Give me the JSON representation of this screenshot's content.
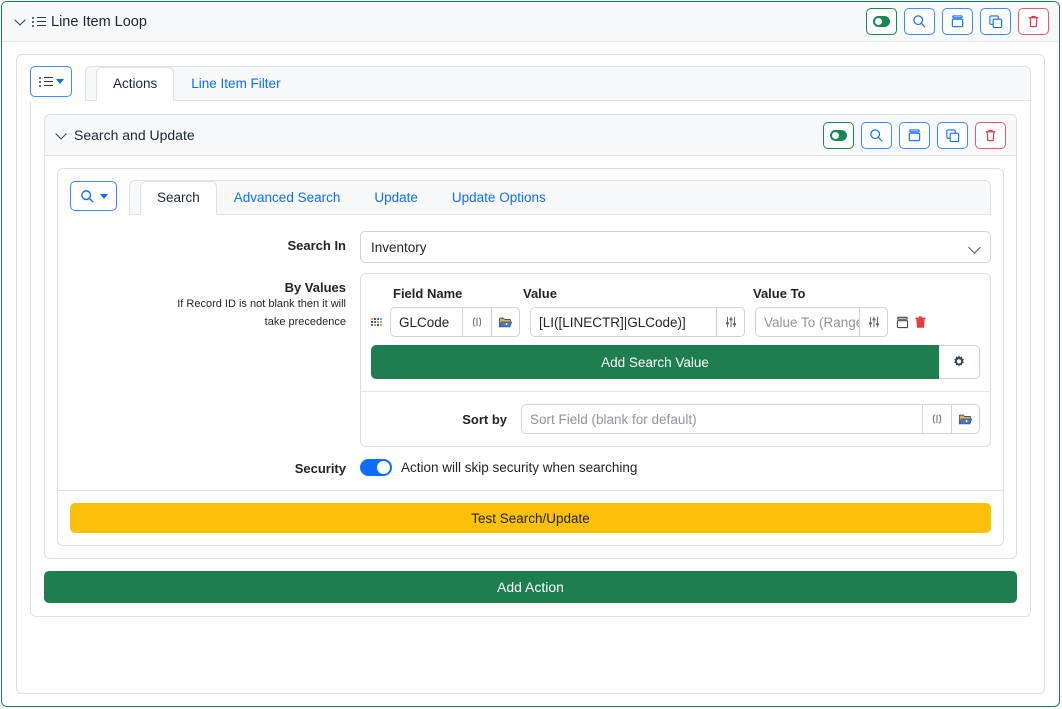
{
  "outer": {
    "title": "Line Item Loop",
    "collapse_icon": "chevron-down-icon",
    "list_icon": "list-icon",
    "toolbar": [
      {
        "name": "enable-toggle",
        "icon": "toggle-on-icon",
        "style": "green"
      },
      {
        "name": "search-button",
        "icon": "search-icon",
        "style": "blue"
      },
      {
        "name": "archive-button",
        "icon": "archive-icon",
        "style": "blue"
      },
      {
        "name": "copy-button",
        "icon": "copy-icon",
        "style": "blue"
      },
      {
        "name": "delete-button",
        "icon": "trash-icon",
        "style": "red"
      }
    ]
  },
  "main_tabs": {
    "dropdown_icon": "list-icon",
    "caret_icon": "caret-down-icon",
    "items": [
      {
        "label": "Actions",
        "active": true
      },
      {
        "label": "Line Item Filter",
        "active": false
      }
    ]
  },
  "section": {
    "title": "Search and Update",
    "collapse_icon": "chevron-down-icon",
    "toolbar": [
      {
        "name": "enable-toggle",
        "icon": "toggle-on-icon",
        "style": "green"
      },
      {
        "name": "search-button",
        "icon": "search-icon",
        "style": "blue"
      },
      {
        "name": "archive-button",
        "icon": "archive-icon",
        "style": "blue"
      },
      {
        "name": "copy-button",
        "icon": "copy-icon",
        "style": "blue"
      },
      {
        "name": "delete-button",
        "icon": "trash-icon",
        "style": "red"
      }
    ]
  },
  "action_tabs": {
    "dropdown_icon": "search-icon",
    "caret_icon": "caret-down-icon",
    "items": [
      {
        "label": "Search",
        "active": true
      },
      {
        "label": "Advanced Search",
        "active": false
      },
      {
        "label": "Update",
        "active": false
      },
      {
        "label": "Update Options",
        "active": false
      }
    ]
  },
  "form": {
    "search_in": {
      "label": "Search In",
      "value": "Inventory",
      "chevron_icon": "chevron-down-icon"
    },
    "by_values": {
      "label": "By Values",
      "help_line1": "If Record ID is not blank then it will",
      "help_line2": "take precedence",
      "columns": [
        "Field Name",
        "Value",
        "Value To"
      ],
      "rows": [
        {
          "grip_icon": "drag-grip-icon",
          "field_name": "GLCode",
          "field_name_placeholder": "Field Name",
          "variable_icon": "variable-icon",
          "browse_icon": "folder-open-icon",
          "value": "[LI([LINECTR]|GLCode)]",
          "value_placeholder": "Value",
          "value_filter_icon": "sliders-icon",
          "value_to": "",
          "value_to_placeholder": "Value To (Range)",
          "value_to_filter_icon": "sliders-icon",
          "archive_icon": "archive-icon",
          "delete_icon": "trash-icon"
        }
      ],
      "add_button_label": "Add Search Value",
      "settings_icon": "gear-icon"
    },
    "sort_by": {
      "label": "Sort by",
      "value": "",
      "placeholder": "Sort Field (blank for default)",
      "variable_icon": "variable-icon",
      "browse_icon": "folder-open-icon"
    },
    "security": {
      "label": "Security",
      "toggle_on": true,
      "text": "Action will skip security when searching"
    }
  },
  "buttons": {
    "test": "Test Search/Update",
    "add_action": "Add Action"
  },
  "colors": {
    "green": "#1e7e4f",
    "blue": "#0d6efd",
    "red": "#dc3545",
    "yellow": "#fcc008",
    "header_bg": "#f7f8f9"
  }
}
